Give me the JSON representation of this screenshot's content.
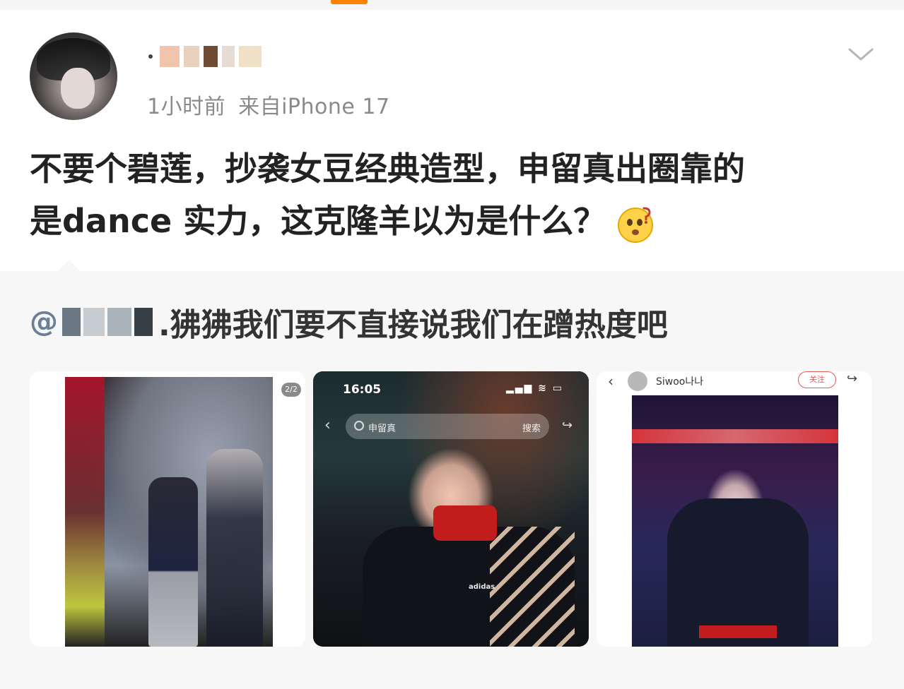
{
  "post": {
    "time": "1小时前",
    "source": "来自iPhone 17",
    "text_line1": "不要个碧莲，抄袭女豆经典造型，申留真出圈靠的",
    "text_line2": "是dance 实力，这克隆羊以为是什么？"
  },
  "repost": {
    "mention_prefix": "@",
    "text": ".狒狒我们要不直接说我们在蹭热度吧"
  },
  "images": [
    {
      "badge": "2/2"
    },
    {
      "status_time": "16:05",
      "status_icons": "▂▄▆ ≋ ▭",
      "search_query": "申留真",
      "search_button": "搜索",
      "brand_logo": "adidas"
    },
    {
      "username": "Siwoo나나",
      "follow_label": "关注"
    }
  ],
  "icons": {
    "chevron": "chevron-down-icon",
    "emoji": "confused-face-emoji",
    "back": "back-arrow-icon",
    "share": "share-icon",
    "search": "search-icon"
  },
  "colors": {
    "accent": "#ff8200",
    "meta_gray": "#8a8a8a",
    "follow_red": "#e25b5b"
  }
}
